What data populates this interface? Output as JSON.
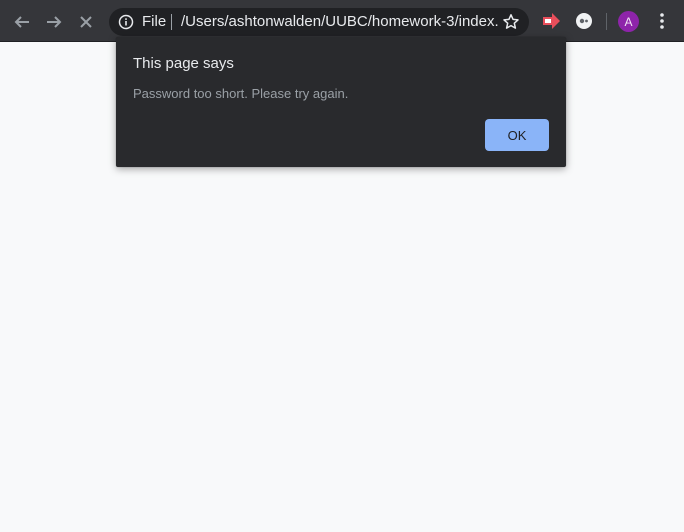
{
  "toolbar": {
    "back_icon": "arrow-left-icon",
    "forward_icon": "arrow-right-icon",
    "stop_icon": "close-icon",
    "omnibox": {
      "security_icon": "info-icon",
      "scheme_label": "File",
      "url": "/Users/ashtonwalden/UUBC/homework-3/index...",
      "bookmark_icon": "star-icon"
    },
    "extensions": [
      "red-arrow-extension-icon",
      "white-circle-extension-icon"
    ],
    "profile_initial": "A",
    "menu_icon": "three-dots-vertical-icon"
  },
  "dialog": {
    "title": "This page says",
    "message": "Password too short. Please try again.",
    "ok_label": "OK"
  },
  "colors": {
    "toolbar_bg": "#35363a",
    "omnibox_bg": "#202124",
    "dialog_bg": "#292a2d",
    "button_accent": "#8ab4f8",
    "avatar": "#8e24aa",
    "page_bg": "#f8f9fa"
  }
}
